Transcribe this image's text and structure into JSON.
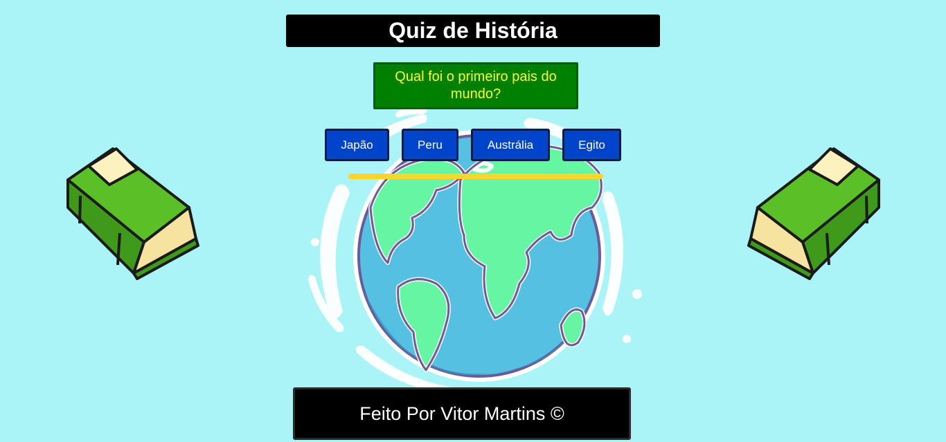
{
  "header": {
    "title": "Quiz de História"
  },
  "question": {
    "text": "Qual foi o primeiro pais do mundo?"
  },
  "answers": [
    {
      "label": "Japão"
    },
    {
      "label": "Peru"
    },
    {
      "label": "Austrália"
    },
    {
      "label": "Egito"
    }
  ],
  "progress": {
    "value": 1.0,
    "color": "#fbd52a"
  },
  "footer": {
    "text": "Feito Por Vitor Martins ©"
  },
  "images": {
    "left": "book-illustration",
    "center": "earth-globe-illustration",
    "right": "book-illustration"
  },
  "colors": {
    "background": "#aaf3f7",
    "question_bg": "#008000",
    "question_text": "#ffff33",
    "answer_bg": "#0044cc",
    "bars": "#000000"
  }
}
